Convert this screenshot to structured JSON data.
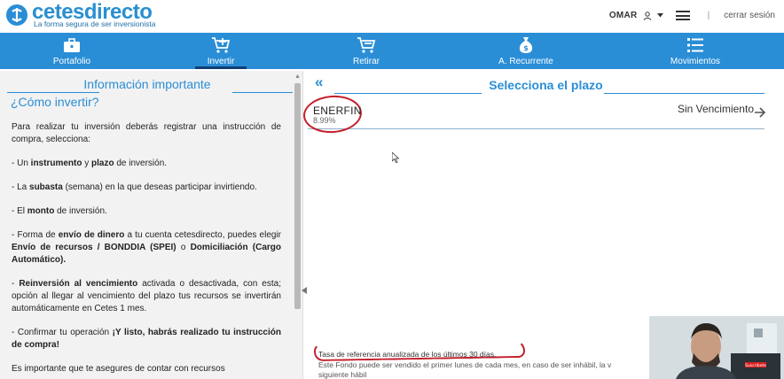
{
  "header": {
    "logo_text": "cetesdirecto",
    "logo_tagline": "La forma segura de ser inversionista",
    "user_name": "OMAR",
    "separator": "|",
    "logout_label": "cerrar sesión"
  },
  "nav": {
    "items": [
      {
        "label": "Portafolio",
        "icon": "briefcase-icon",
        "active": false
      },
      {
        "label": "Invertir",
        "icon": "cart-plus-icon",
        "active": true
      },
      {
        "label": "Retirar",
        "icon": "cart-minus-icon",
        "active": false
      },
      {
        "label": "A. Recurrente",
        "icon": "money-bag-icon",
        "active": false
      },
      {
        "label": "Movimientos",
        "icon": "list-icon",
        "active": false
      }
    ]
  },
  "left_panel": {
    "title": "Información importante",
    "heading": "¿Cómo invertir?",
    "paragraphs": [
      [
        {
          "t": "Para realizar tu inversión deberás registrar una instrucción de compra, selecciona:",
          "b": false
        }
      ],
      [
        {
          "t": "- Un ",
          "b": false
        },
        {
          "t": "instrumento",
          "b": true
        },
        {
          "t": " y ",
          "b": false
        },
        {
          "t": "plazo",
          "b": true
        },
        {
          "t": " de inversión.",
          "b": false
        }
      ],
      [
        {
          "t": "- La ",
          "b": false
        },
        {
          "t": "subasta",
          "b": true
        },
        {
          "t": " (semana) en la que deseas participar invirtiendo.",
          "b": false
        }
      ],
      [
        {
          "t": "- El ",
          "b": false
        },
        {
          "t": "monto",
          "b": true
        },
        {
          "t": " de inversión.",
          "b": false
        }
      ],
      [
        {
          "t": "- Forma de ",
          "b": false
        },
        {
          "t": "envío de dinero",
          "b": true
        },
        {
          "t": " a tu cuenta cetesdirecto, puedes elegir ",
          "b": false
        },
        {
          "t": "Envío de recursos / BONDDIA (SPEI)",
          "b": true
        },
        {
          "t": " o ",
          "b": false
        },
        {
          "t": "Domiciliación (Cargo Automático).",
          "b": true
        }
      ],
      [
        {
          "t": "- ",
          "b": false
        },
        {
          "t": "Reinversión al vencimiento",
          "b": true
        },
        {
          "t": " activada o desactivada, con esta; opción al llegar al vencimiento del plazo tus recursos se invertirán automáticamente en Cetes 1 mes.",
          "b": false
        }
      ],
      [
        {
          "t": "- Confirmar tu operación ",
          "b": false
        },
        {
          "t": "¡Y listo, habrás realizado tu instrucción de compra!",
          "b": true
        }
      ],
      [
        {
          "t": "Es importante que te asegures de contar con recursos",
          "b": false
        }
      ]
    ]
  },
  "right_panel": {
    "back_label": "«",
    "title": "Selecciona el plazo",
    "fund": {
      "name": "ENERFIN",
      "rate": "8.99%",
      "term": "Sin Vencimiento"
    },
    "footnotes": [
      "Tasa de referencia anualizada de los últimos 30 días.",
      "Este Fondo puede ser vendido el primer lunes de cada mes, en caso de ser inhábil, la v",
      "siguiente hábil"
    ]
  },
  "webcam": {
    "badge": "Suscríbete"
  },
  "colors": {
    "brand_blue": "#2a8ed6",
    "nav_active_indicator": "#0e3f73",
    "annotation_red": "#c41e2a"
  }
}
